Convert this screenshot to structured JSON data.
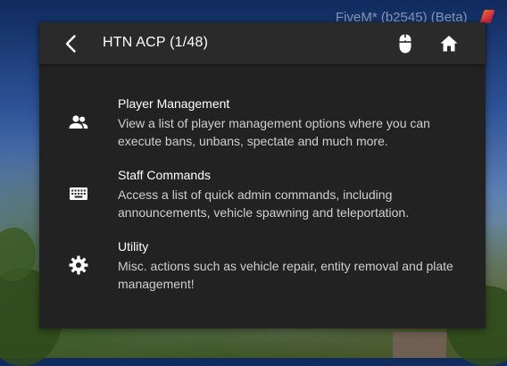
{
  "watermark": {
    "text": "FiveM* (b2545) (Beta)"
  },
  "header": {
    "title": "HTN ACP (1/48)",
    "icons": [
      "chevron-left-icon",
      "mouse-icon",
      "home-icon"
    ]
  },
  "menu": {
    "items": [
      {
        "title": "Player Management",
        "description": "View a list of player management options where you can execute bans, unbans, spectate and much more.",
        "icon": "people-icon"
      },
      {
        "title": "Staff Commands",
        "description": "Access a list of quick admin commands, including announcements, vehicle spawning and teleportation.",
        "icon": "keyboard-icon"
      },
      {
        "title": "Utility",
        "description": "Misc. actions such as vehicle repair, entity removal and plate management!",
        "icon": "gear-icon"
      }
    ]
  },
  "colors": {
    "panel": "#222222",
    "header": "#2a2a2a",
    "text": "#ffffff",
    "muted_text": "#cfcfcf"
  }
}
